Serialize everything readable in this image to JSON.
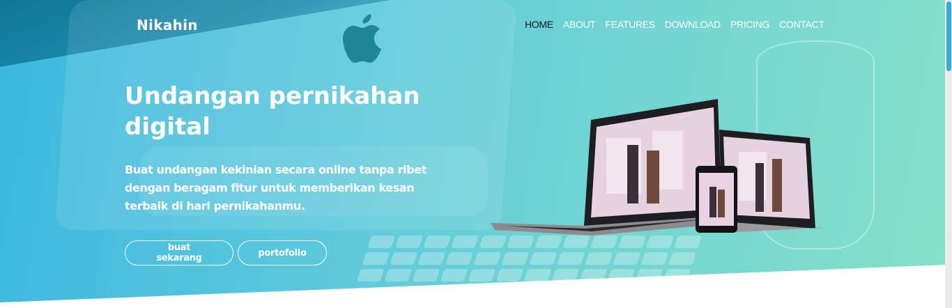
{
  "brand": {
    "name": "Nikahin"
  },
  "nav": {
    "items": [
      {
        "label": "HOME",
        "active": true
      },
      {
        "label": "ABOUT"
      },
      {
        "label": "FEATURES"
      },
      {
        "label": "DOWNLOAD"
      },
      {
        "label": "PRICING"
      },
      {
        "label": "CONTACT"
      }
    ]
  },
  "hero": {
    "headline": "Undangan pernikahan digital",
    "subtitle": "Buat undangan kekinian secara online tanpa ribet dengan beragam fitur untuk memberikan kesan terbaik di hari pernikahanmu.",
    "primary_button": "buat sekarang",
    "secondary_button": "portofolio"
  },
  "colors": {
    "gradient_start": "#3bb7e0",
    "gradient_end": "#86e0c8",
    "accent": "#3aa8d8",
    "nav_active": "#0b1b26"
  },
  "icons": [
    "apple-logo-icon"
  ]
}
